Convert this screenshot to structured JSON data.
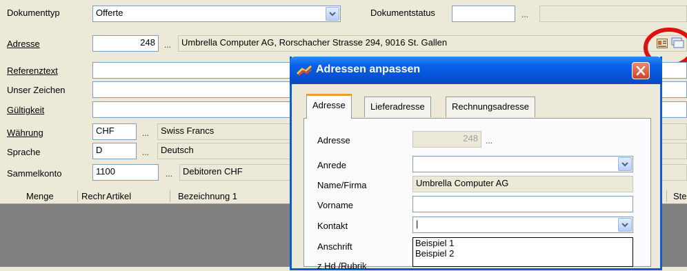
{
  "form": {
    "doc_type_label": "Dokumenttyp",
    "doc_type_value": "Offerte",
    "doc_status_label": "Dokumentstatus",
    "doc_status_dots": "...",
    "address_label": "Adresse",
    "address_number": "248",
    "address_dots": "...",
    "address_text": "Umbrella Computer AG, Rorschacher Strasse 294, 9016 St. Gallen",
    "reference_label": "Referenztext",
    "our_sign_label": "Unser Zeichen",
    "validity_label": "Gültigkeit",
    "currency_label": "Währung",
    "currency_code": "CHF",
    "currency_dots": "...",
    "currency_name": "Swiss Francs",
    "language_label": "Sprache",
    "language_code": "D",
    "language_dots": "...",
    "language_name": "Deutsch",
    "collective_label": "Sammelkonto",
    "collective_code": "1100",
    "collective_dots": "...",
    "collective_name": "Debitoren CHF"
  },
  "grid": {
    "columns": [
      "Menge",
      "Rechr",
      "Artikel",
      "Bezeichnung 1",
      "Ste"
    ]
  },
  "dialog": {
    "title": "Adressen anpassen",
    "tabs": [
      {
        "label": "Adresse",
        "active": true
      },
      {
        "label": "Lieferadresse",
        "active": false
      },
      {
        "label": "Rechnungsadresse",
        "active": false
      }
    ],
    "adresse_label": "Adresse",
    "adresse_value": "248",
    "adresse_dots": "...",
    "anrede_label": "Anrede",
    "anrede_value": "",
    "name_label": "Name/Firma",
    "name_value": "Umbrella Computer AG",
    "vorname_label": "Vorname",
    "vorname_value": "",
    "kontakt_label": "Kontakt",
    "kontakt_value": "|",
    "anschrift_label": "Anschrift",
    "cut_label": "z Hd /Rubrik",
    "kontakt_options": [
      "Beispiel 1",
      "Beispiel 2"
    ]
  },
  "colors": {
    "highlight_circle": "#e01010",
    "titlebar": "#0a5dd6",
    "tab_active_accent": "#e8a030"
  },
  "icons": [
    "contact-card-icon",
    "address-cards-icon",
    "app-icon",
    "close-icon",
    "chevron-down-icon"
  ]
}
